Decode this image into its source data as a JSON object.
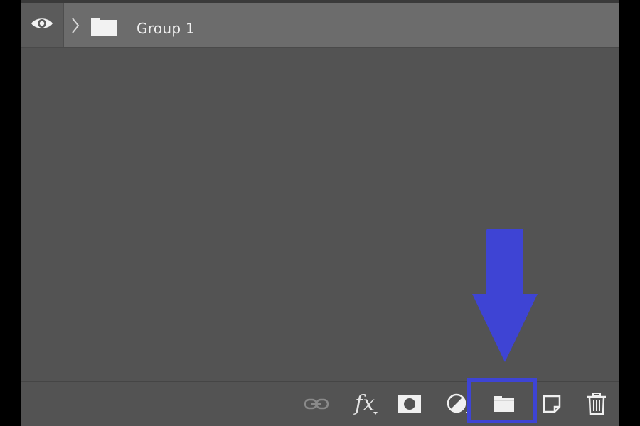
{
  "layers": [
    {
      "name": "Group 1",
      "type": "group",
      "visible": true,
      "expanded": false
    }
  ],
  "bottom_toolbar": {
    "link_layers": {
      "icon": "link-icon",
      "enabled": false
    },
    "add_layer_style": {
      "icon": "fx-icon",
      "label": "fx"
    },
    "add_layer_mask": {
      "icon": "mask-icon"
    },
    "new_adjustment_layer": {
      "icon": "adjustment-icon"
    },
    "new_group": {
      "icon": "folder-icon",
      "highlighted": true
    },
    "new_layer": {
      "icon": "new-layer-icon"
    },
    "delete_layer": {
      "icon": "trash-icon"
    }
  },
  "colors": {
    "panel_bg": "#535353",
    "row_bg": "#6c6c6c",
    "annotation": "#3e44d4"
  }
}
